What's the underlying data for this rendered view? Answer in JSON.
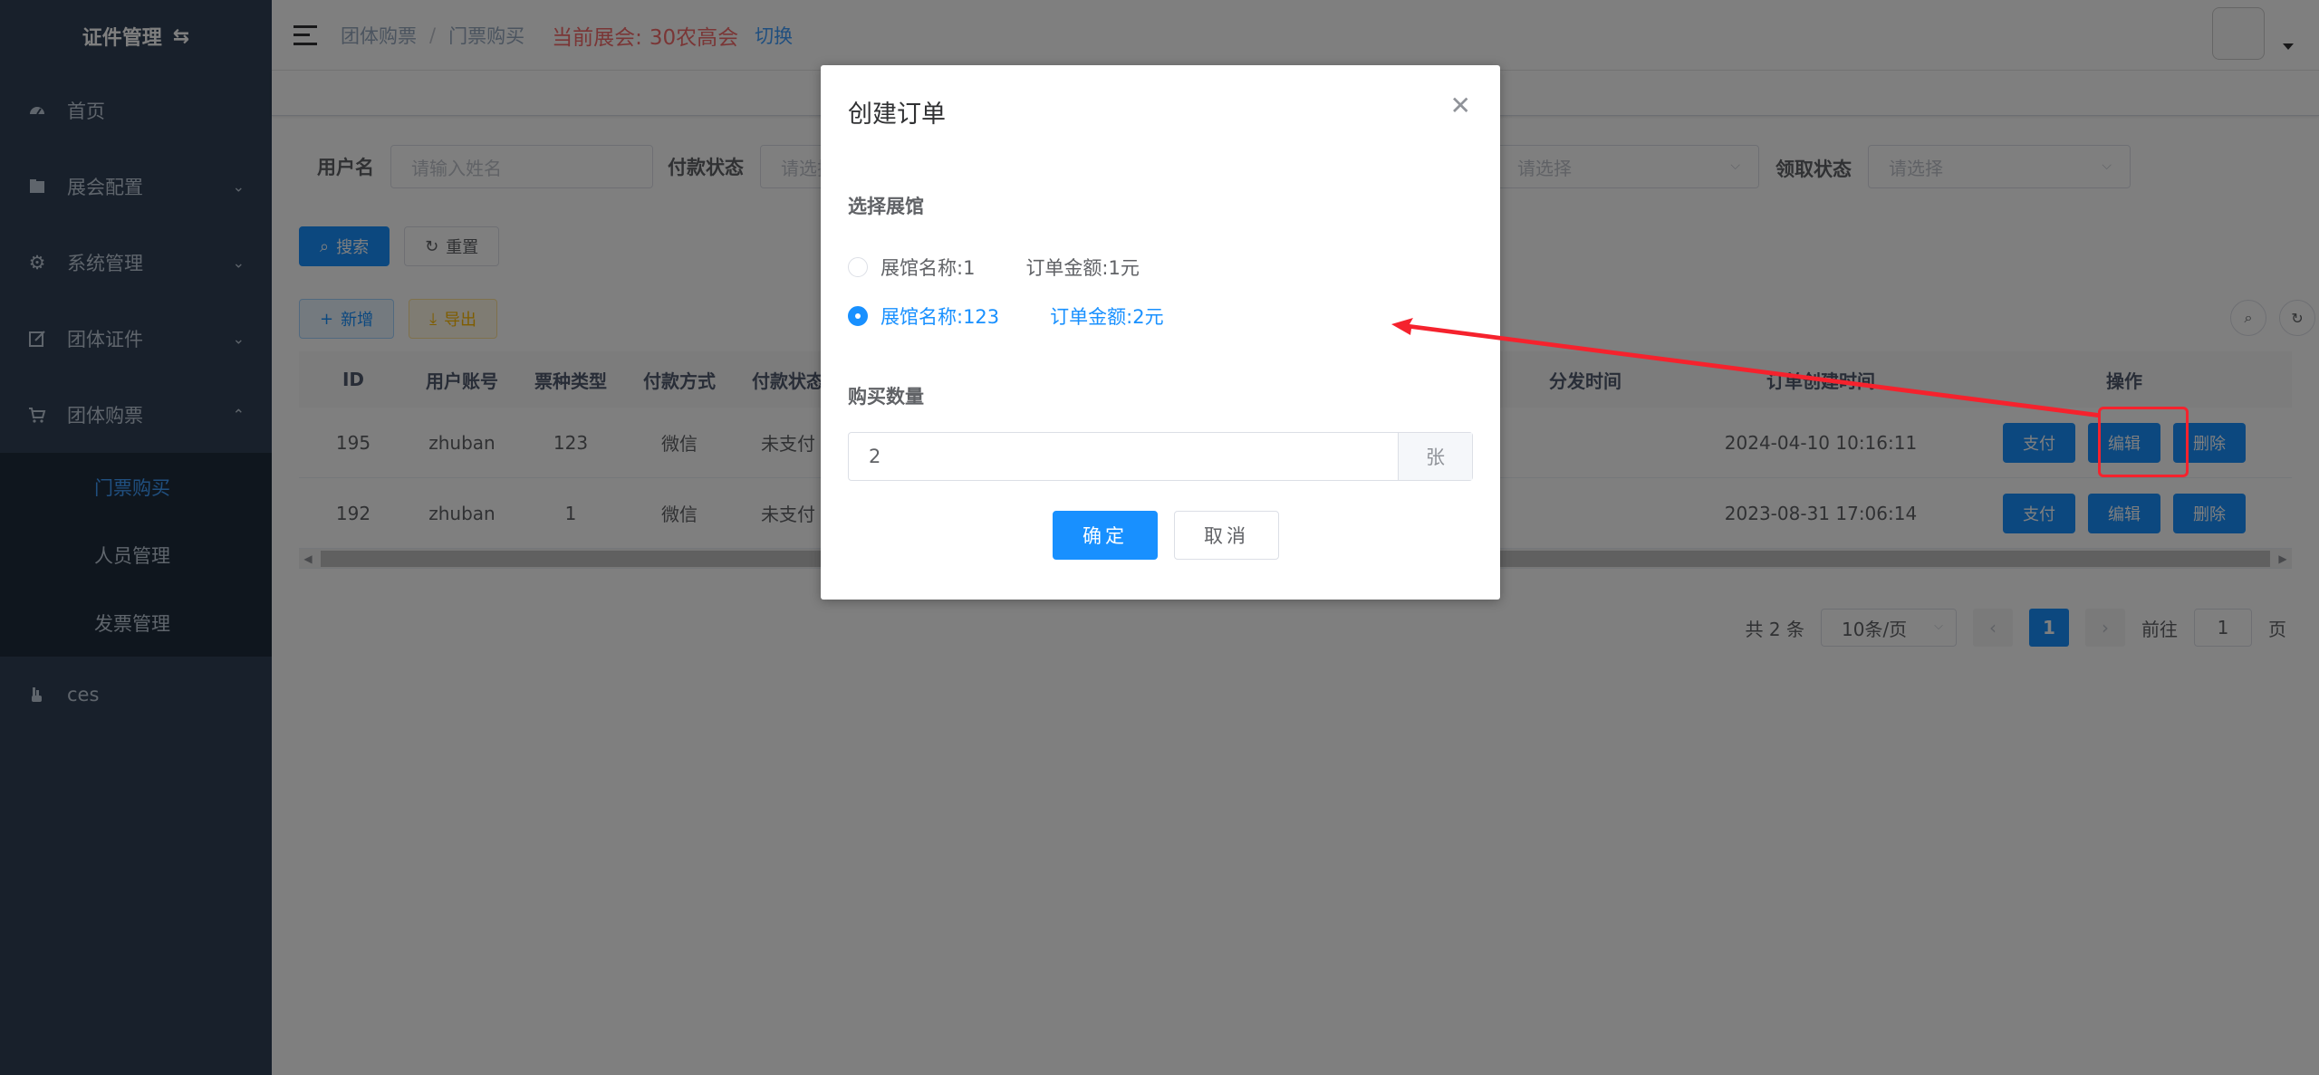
{
  "sidebar": {
    "logo": "证件管理",
    "items": [
      {
        "label": "首页",
        "icon": "dashboard-icon"
      },
      {
        "label": "展会配置",
        "icon": "folder-icon"
      },
      {
        "label": "系统管理",
        "icon": "gear-icon"
      },
      {
        "label": "团体证件",
        "icon": "edit-icon"
      },
      {
        "label": "团体购票",
        "icon": "cart-icon"
      },
      {
        "label": "ces",
        "icon": "hand-icon"
      }
    ],
    "submenu": [
      {
        "label": "门票购买",
        "active": true
      },
      {
        "label": "人员管理"
      },
      {
        "label": "发票管理"
      }
    ]
  },
  "header": {
    "breadcrumb": [
      "团体购票",
      "门票购买"
    ],
    "expo_label": "当前展会:",
    "expo_value": "30农高会",
    "switch_label": "切换"
  },
  "search": {
    "user_label": "用户名",
    "user_placeholder": "请输入姓名",
    "pay_status_label": "付款状态",
    "pay_status_placeholder": "请选择",
    "third_placeholder": "请选择",
    "receive_label": "领取状态",
    "receive_placeholder": "请选择",
    "search_btn": "搜索",
    "reset_btn": "重置"
  },
  "toolbar": {
    "add_btn": "新增",
    "export_btn": "导出"
  },
  "table": {
    "headers": {
      "id": "ID",
      "account": "用户账号",
      "ticket_type": "票种类型",
      "pay_method": "付款方式",
      "pay_status": "付款状态",
      "dist_time": "分发时间",
      "created_time": "订单创建时间",
      "ops": "操作"
    },
    "rows": [
      {
        "id": "195",
        "account": "zhuban",
        "ticket_type": "123",
        "pay_method": "微信",
        "pay_status": "未支付",
        "dist_time": "",
        "created_time": "2024-04-10 10:16:11",
        "pay_btn": "支付",
        "edit_btn": "编辑",
        "delete_btn": "删除"
      },
      {
        "id": "192",
        "account": "zhuban",
        "ticket_type": "1",
        "pay_method": "微信",
        "pay_status": "未支付",
        "dist_time": "",
        "created_time": "2023-08-31 17:06:14",
        "pay_btn": "支付",
        "edit_btn": "编辑",
        "delete_btn": "删除"
      }
    ]
  },
  "pagination": {
    "total": "共 2 条",
    "page_size": "10条/页",
    "current_page": "1",
    "goto_label": "前往",
    "goto_value": "1",
    "page_unit": "页"
  },
  "dialog": {
    "title": "创建订单",
    "venue_label": "选择展馆",
    "options": [
      {
        "venue": "展馆名称:1",
        "amount": "订单金额:1元",
        "checked": false
      },
      {
        "venue": "展馆名称:123",
        "amount": "订单金额:2元",
        "checked": true
      }
    ],
    "qty_label": "购买数量",
    "qty_value": "2",
    "qty_unit": "张",
    "ok_btn": "确定",
    "cancel_btn": "取消"
  },
  "colors": {
    "primary": "#1890ff",
    "sidebar_bg": "#304156",
    "annotation": "#f5222d",
    "expo_red": "#f56c6c"
  }
}
